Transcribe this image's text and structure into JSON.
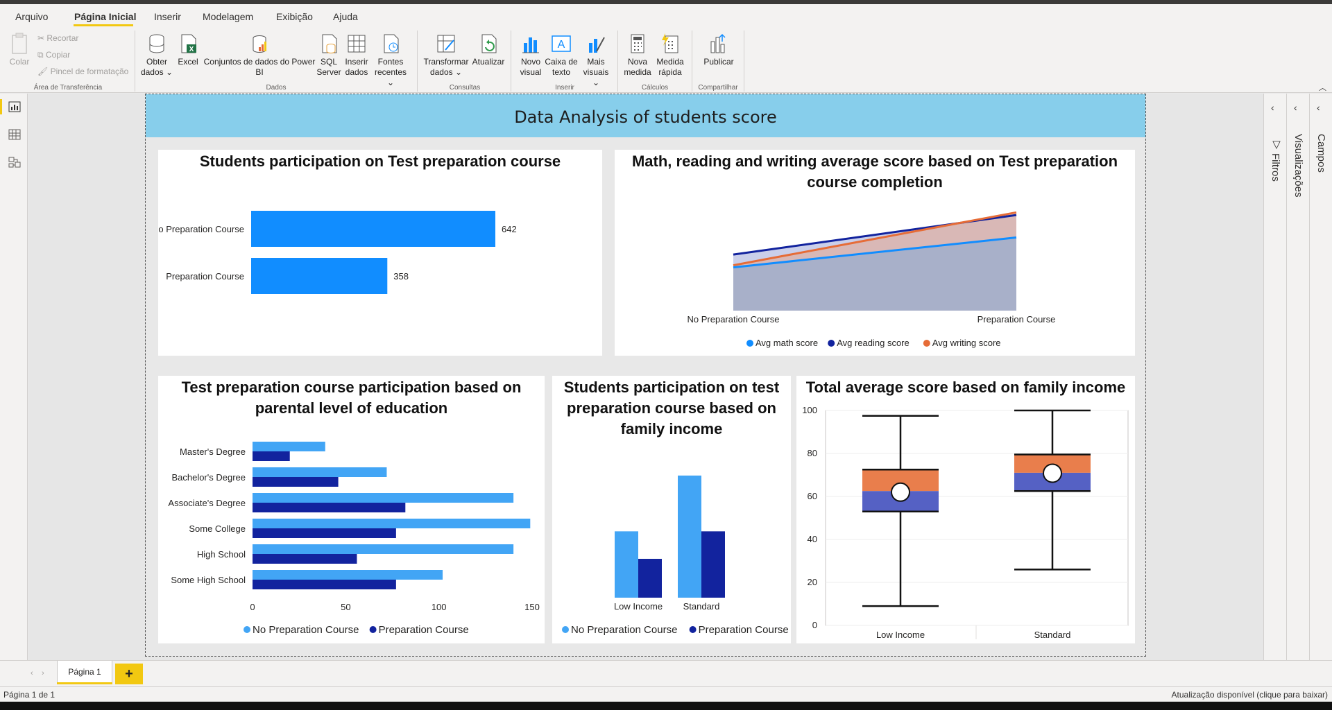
{
  "menu": {
    "items": [
      "Arquivo",
      "Página Inicial",
      "Inserir",
      "Modelagem",
      "Exibição",
      "Ajuda"
    ],
    "active_index": 1
  },
  "ribbon": {
    "clipboard": {
      "paste": "Colar",
      "cut": "Recortar",
      "copy": "Copiar",
      "format_painter": "Pincel de formatação",
      "group": "Área de Transferência"
    },
    "data": {
      "get_data": [
        "Obter",
        "dados"
      ],
      "excel": "Excel",
      "datasets": [
        "Conjuntos de dados do Power",
        "BI"
      ],
      "sql": [
        "SQL",
        "Server"
      ],
      "enter_data": [
        "Inserir",
        "dados"
      ],
      "recent": [
        "Fontes",
        "recentes"
      ],
      "group": "Dados"
    },
    "queries": {
      "transform": [
        "Transformar",
        "dados"
      ],
      "refresh": "Atualizar",
      "group": "Consultas"
    },
    "insert": {
      "new_visual": [
        "Novo",
        "visual"
      ],
      "text_box": [
        "Caixa de",
        "texto"
      ],
      "more_visuals": [
        "Mais",
        "visuais"
      ],
      "group": "Inserir"
    },
    "calculations": {
      "new_measure": [
        "Nova",
        "medida"
      ],
      "quick_measure": [
        "Medida",
        "rápida"
      ],
      "group": "Cálculos"
    },
    "share": {
      "publish": "Publicar",
      "group": "Compartilhar"
    }
  },
  "report": {
    "title": "Data Analysis of students score"
  },
  "panes": {
    "filters": "Filtros",
    "visualizations": "Visualizações",
    "fields": "Campos"
  },
  "pages": {
    "tabs": [
      "Página 1"
    ],
    "add": "+"
  },
  "status": {
    "page_info": "Página 1 de 1",
    "update": "Atualização disponível (clique para baixar)"
  },
  "colors": {
    "accent": "#f2c811",
    "banner": "#87ceeb",
    "bar_blue": "#118dff",
    "light_blue": "#42a5f5",
    "navy": "#12239e",
    "orange": "#e66c37",
    "box_orange": "#e97e4c",
    "box_blue": "#5561c4"
  },
  "chart_data": [
    {
      "type": "bar",
      "title": "Students participation on Test preparation course",
      "orientation": "horizontal",
      "categories": [
        "No Preparation Course",
        "Preparation Course"
      ],
      "values": [
        642,
        358
      ],
      "xlim": [
        0,
        642
      ],
      "data_labels": [
        "642",
        "358"
      ]
    },
    {
      "type": "area",
      "title": "Math, reading and writing average score based on Test preparation course completion",
      "categories": [
        "No Preparation Course",
        "Preparation Course"
      ],
      "series": [
        {
          "name": "Avg math score",
          "values": [
            64.1,
            69.7
          ],
          "color": "#118dff"
        },
        {
          "name": "Avg reading score",
          "values": [
            66.5,
            73.9
          ],
          "color": "#12239e"
        },
        {
          "name": "Avg writing score",
          "values": [
            64.5,
            74.4
          ],
          "color": "#e66c37"
        }
      ],
      "ylim": [
        56,
        76
      ],
      "legend": "bottom"
    },
    {
      "type": "bar",
      "title": "Test preparation course participation based on parental level of education",
      "orientation": "horizontal",
      "categories": [
        "Master's Degree",
        "Bachelor's Degree",
        "Associate's Degree",
        "Some College",
        "High School",
        "Some High School"
      ],
      "series": [
        {
          "name": "No Preparation Course",
          "values": [
            39,
            72,
            140,
            149,
            140,
            102
          ],
          "color": "#42a5f5"
        },
        {
          "name": "Preparation Course",
          "values": [
            20,
            46,
            82,
            77,
            56,
            77
          ],
          "color": "#12239e"
        }
      ],
      "xlim": [
        0,
        150
      ],
      "xticks": [
        0,
        50,
        100,
        150
      ],
      "legend": "bottom"
    },
    {
      "type": "bar",
      "title": "Students participation on test preparation course based on family income",
      "categories": [
        "Low Income",
        "Standard"
      ],
      "series": [
        {
          "name": "No Preparation Course",
          "values": [
            227,
            418
          ],
          "color": "#42a5f5"
        },
        {
          "name": "Preparation Course",
          "values": [
            133,
            227
          ],
          "color": "#12239e"
        }
      ],
      "ylim": [
        0,
        420
      ],
      "legend": "bottom"
    },
    {
      "type": "box",
      "title": "Total average score based on family income",
      "categories": [
        "Low Income",
        "Standard"
      ],
      "boxes": [
        {
          "min": 9,
          "q1": 53,
          "median": 62.5,
          "q3": 72.5,
          "max": 97.5,
          "mean": 62
        },
        {
          "min": 26,
          "q1": 62.5,
          "median": 71,
          "q3": 79.5,
          "max": 100,
          "mean": 70.8
        }
      ],
      "ylim": [
        0,
        100
      ],
      "yticks": [
        0,
        20,
        40,
        60,
        80,
        100
      ]
    }
  ]
}
